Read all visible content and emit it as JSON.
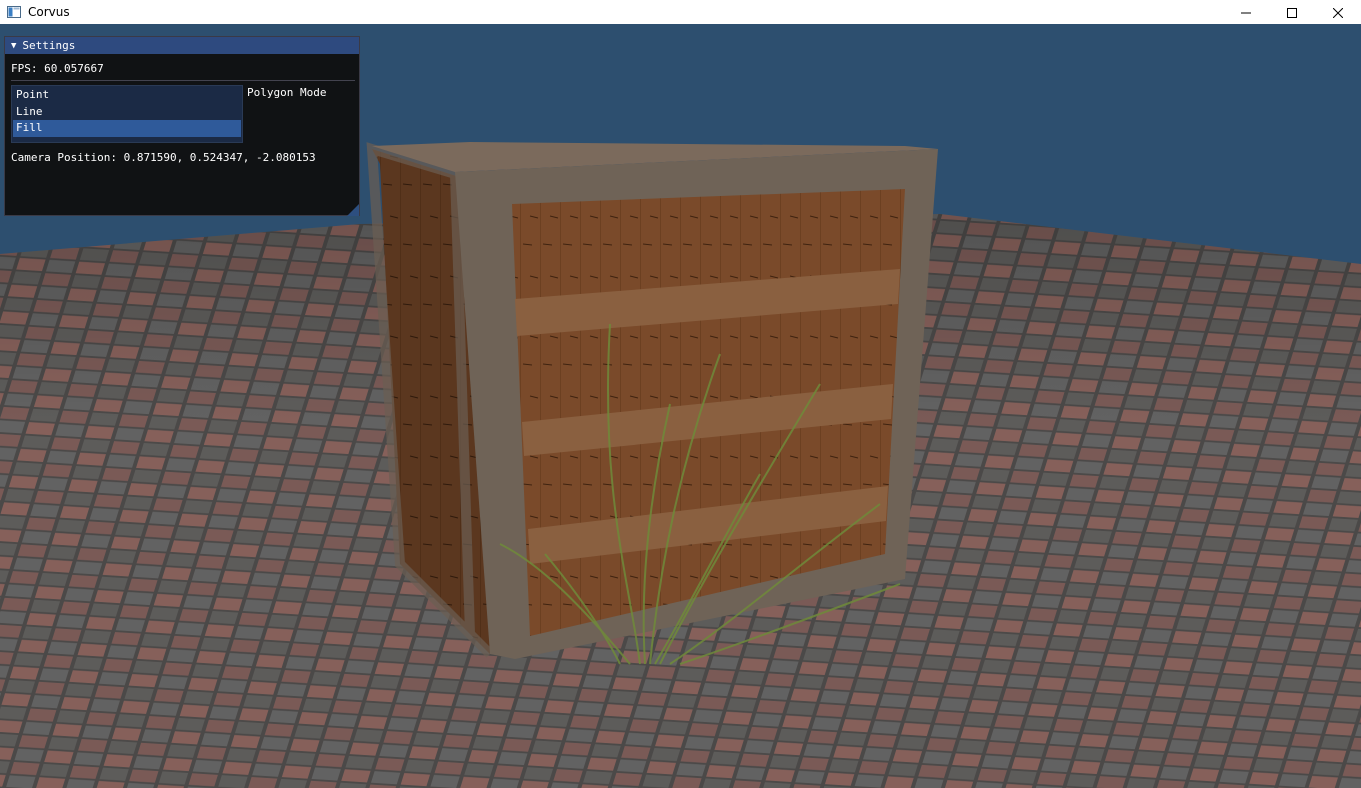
{
  "window": {
    "title": "Corvus",
    "icon": "app-window-icon",
    "controls": [
      "minimize-icon",
      "maximize-icon",
      "close-icon"
    ]
  },
  "viewport": {
    "background_color": "#2d4f6f"
  },
  "settings_panel": {
    "title": "Settings",
    "collapse_icon": "triangle-down-icon",
    "fps_text": "FPS: 60.057667",
    "polygon_mode": {
      "label": "Polygon Mode",
      "options": [
        "Point",
        "Line",
        "Fill"
      ],
      "selected": "Fill"
    },
    "camera_text": "Camera Position: 0.871590, 0.524347, -2.080153",
    "colors": {
      "header": "#2e4a7f",
      "listbox_bg": "#1b2a45",
      "selected_item": "#2f5a9a"
    }
  }
}
